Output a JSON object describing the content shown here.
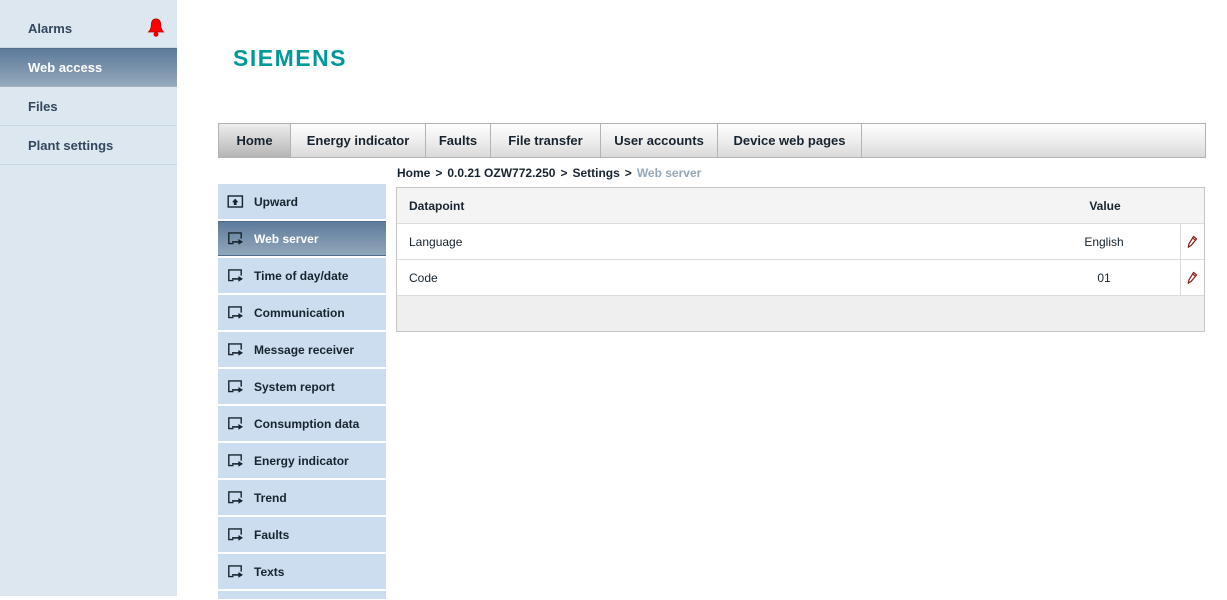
{
  "brand": {
    "name": "SIEMENS",
    "color": "#009999"
  },
  "colors": {
    "alarm_red": "#ff0000",
    "edit_pencil_red": "#8c1713",
    "selected_gradient_top": "#5e7b9c",
    "selected_gradient_bottom": "#93a8bb",
    "sidebar_bg": "#dde7f0",
    "secondary_nav_bg": "#cbddee"
  },
  "primary_nav": {
    "items": [
      {
        "label": "Alarms",
        "alarm": true
      },
      {
        "label": "Web access",
        "selected": true
      },
      {
        "label": "Files"
      },
      {
        "label": "Plant settings"
      }
    ]
  },
  "tabs": {
    "items": [
      {
        "label": "Home",
        "active": true
      },
      {
        "label": "Energy indicator"
      },
      {
        "label": "Faults"
      },
      {
        "label": "File transfer"
      },
      {
        "label": "User accounts"
      },
      {
        "label": "Device web pages"
      }
    ]
  },
  "breadcrumb": {
    "separator": ">",
    "links": [
      "Home",
      "0.0.21 OZW772.250",
      "Settings"
    ],
    "current": "Web server"
  },
  "secondary_nav": {
    "items": [
      {
        "label": "Upward",
        "icon": "upward-icon"
      },
      {
        "label": "Web server",
        "icon": "page-export-icon",
        "selected": true
      },
      {
        "label": "Time of day/date",
        "icon": "page-export-icon"
      },
      {
        "label": "Communication",
        "icon": "page-export-icon"
      },
      {
        "label": "Message receiver",
        "icon": "page-export-icon"
      },
      {
        "label": "System report",
        "icon": "page-export-icon"
      },
      {
        "label": "Consumption data",
        "icon": "page-export-icon"
      },
      {
        "label": "Energy indicator",
        "icon": "page-export-icon"
      },
      {
        "label": "Trend",
        "icon": "page-export-icon"
      },
      {
        "label": "Faults",
        "icon": "page-export-icon"
      },
      {
        "label": "Texts",
        "icon": "page-export-icon"
      }
    ]
  },
  "datapoint_table": {
    "columns": {
      "datapoint": "Datapoint",
      "value": "Value"
    },
    "rows": [
      {
        "datapoint": "Language",
        "value": "English",
        "editable": true
      },
      {
        "datapoint": "Code",
        "value": "01",
        "editable": true
      }
    ]
  }
}
